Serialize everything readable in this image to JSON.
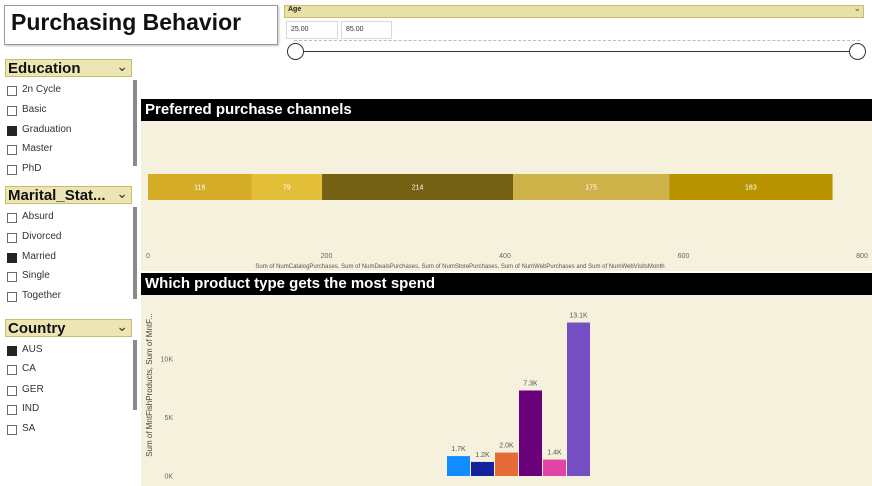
{
  "title": "Purchasing Behavior",
  "age_slicer": {
    "header": "Age",
    "min_value": "25.00",
    "max_value": "85.00"
  },
  "slicers": [
    {
      "id": "education",
      "title": "Education",
      "items": [
        {
          "label": "2n Cycle",
          "checked": false
        },
        {
          "label": "Basic",
          "checked": false
        },
        {
          "label": "Graduation",
          "checked": true
        },
        {
          "label": "Master",
          "checked": false
        },
        {
          "label": "PhD",
          "checked": false
        }
      ]
    },
    {
      "id": "marital-status",
      "title": "Marital_Stat...",
      "items": [
        {
          "label": "Absurd",
          "checked": false
        },
        {
          "label": "Divorced",
          "checked": false
        },
        {
          "label": "Married",
          "checked": true
        },
        {
          "label": "Single",
          "checked": false
        },
        {
          "label": "Together",
          "checked": false
        }
      ]
    },
    {
      "id": "country",
      "title": "Country",
      "items": [
        {
          "label": "AUS",
          "checked": true
        },
        {
          "label": "CA",
          "checked": false
        },
        {
          "label": "GER",
          "checked": false
        },
        {
          "label": "IND",
          "checked": false
        },
        {
          "label": "SA",
          "checked": false
        }
      ]
    }
  ],
  "chart_data": [
    {
      "type": "bar",
      "orientation": "horizontal-stacked",
      "title": "Preferred purchase channels",
      "xlabel": "Sum of NumCatalogPurchases, Sum of NumDealsPurchases, Sum of NumStorePurchases, Sum of NumWebPurchases and Sum of NumWebVisitsMonth",
      "xlim": [
        0,
        800
      ],
      "xticks": [
        "0",
        "200",
        "400",
        "600",
        "800"
      ],
      "series": [
        {
          "values": [
            116
          ],
          "label": "116",
          "color": "#d4ac26"
        },
        {
          "values": [
            79
          ],
          "label": "79",
          "color": "#e3bf3a"
        },
        {
          "values": [
            214
          ],
          "label": "214",
          "color": "#756114"
        },
        {
          "values": [
            175
          ],
          "label": "175",
          "color": "#cdb149"
        },
        {
          "values": [
            183
          ],
          "label": "183",
          "color": "#b89400"
        }
      ]
    },
    {
      "type": "bar",
      "title": "Which product type gets the most spend",
      "ylabel": "Sum of MntFishProducts, Sum of MntF...",
      "ylim": [
        0,
        14000
      ],
      "yticks": [
        "0K",
        "5K",
        "10K"
      ],
      "series": [
        {
          "values": [
            1700
          ],
          "label": "1.7K",
          "color": "#118dff"
        },
        {
          "values": [
            1200
          ],
          "label": "1.2K",
          "color": "#12239e"
        },
        {
          "values": [
            2000
          ],
          "label": "2.0K",
          "color": "#e66c37"
        },
        {
          "values": [
            7300
          ],
          "label": "7.3K",
          "color": "#6b007b"
        },
        {
          "values": [
            1400
          ],
          "label": "1.4K",
          "color": "#e044a7"
        },
        {
          "values": [
            13100
          ],
          "label": "13.1K",
          "color": "#744ec2"
        }
      ]
    }
  ]
}
